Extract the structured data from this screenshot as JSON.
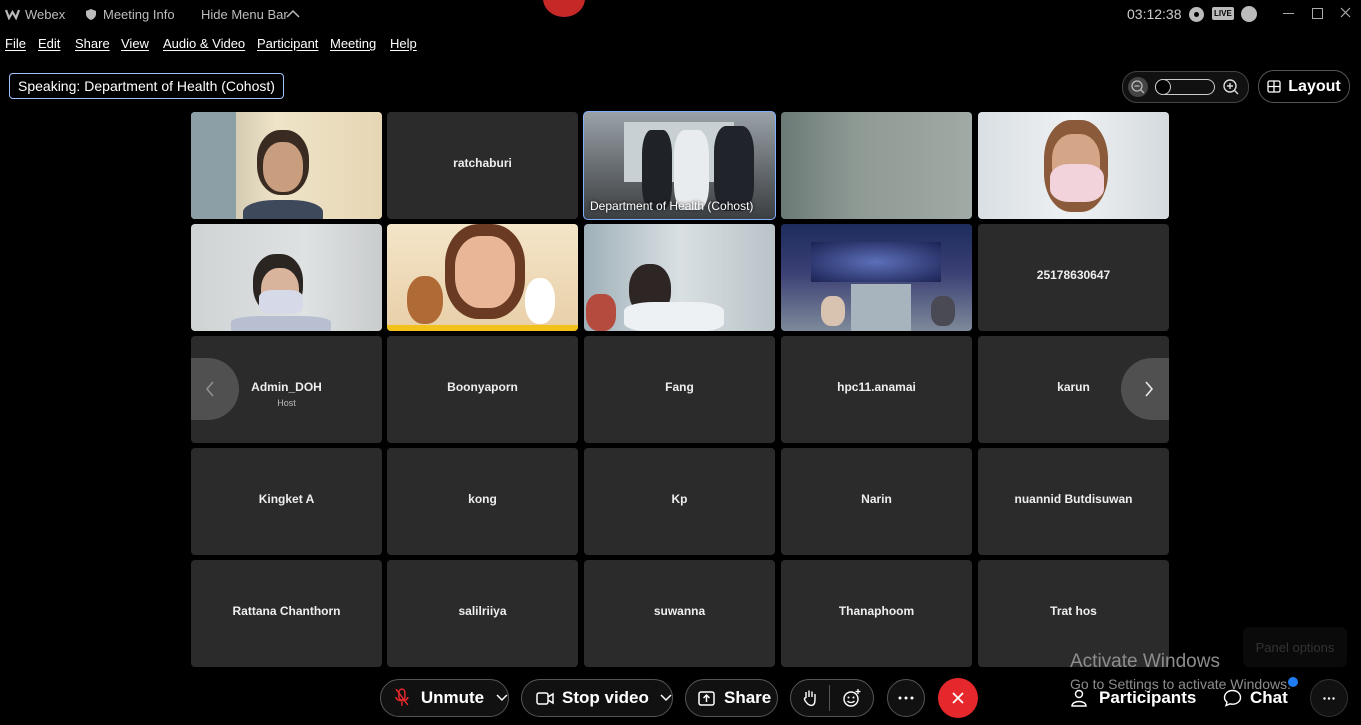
{
  "titlebar": {
    "app_name": "Webex",
    "meeting_info": "Meeting Info",
    "hide_menu_bar": "Hide Menu Bar",
    "clock": "03:12:38",
    "live_badge": "LIVE"
  },
  "menubar": [
    "File",
    "Edit",
    "Share",
    "View",
    "Audio & Video",
    "Participant",
    "Meeting",
    "Help"
  ],
  "speaking": {
    "label": "Speaking:",
    "name": "Department of Health (Cohost)"
  },
  "layout_button": "Layout",
  "tiles": [
    {
      "name": "",
      "video": "woman-office"
    },
    {
      "name": "ratchaburi"
    },
    {
      "name": "Department of Health (Cohost)",
      "video": "group-room",
      "active": true
    },
    {
      "name": "",
      "video": "blurred"
    },
    {
      "name": "",
      "video": "woman-mask"
    },
    {
      "name": "",
      "video": "person-mask"
    },
    {
      "name": "",
      "video": "woman-smiling"
    },
    {
      "name": "",
      "video": "lab"
    },
    {
      "name": "",
      "video": "conference"
    },
    {
      "name": "25178630647"
    },
    {
      "name": "Admin_DOH",
      "sub": "Host"
    },
    {
      "name": "Boonyaporn"
    },
    {
      "name": "Fang"
    },
    {
      "name": "hpc11.anamai"
    },
    {
      "name": "karun"
    },
    {
      "name": "Kingket A"
    },
    {
      "name": "kong"
    },
    {
      "name": "Kp"
    },
    {
      "name": "Narin"
    },
    {
      "name": "nuannid Butdisuwan"
    },
    {
      "name": "Rattana Chanthorn"
    },
    {
      "name": "salilriiya"
    },
    {
      "name": "suwanna"
    },
    {
      "name": "Thanaphoom"
    },
    {
      "name": "Trat hos"
    }
  ],
  "controls": {
    "unmute": "Unmute",
    "stop_video": "Stop video",
    "share": "Share",
    "participants": "Participants",
    "chat": "Chat"
  },
  "watermark": {
    "line1": "Activate Windows",
    "line2": "Go to Settings to activate Windows."
  },
  "panel_options": "Panel options",
  "colors": {
    "end_call": "#e5282b",
    "active_border": "#7fb0ff",
    "tile_bg": "#2b2b2b"
  }
}
